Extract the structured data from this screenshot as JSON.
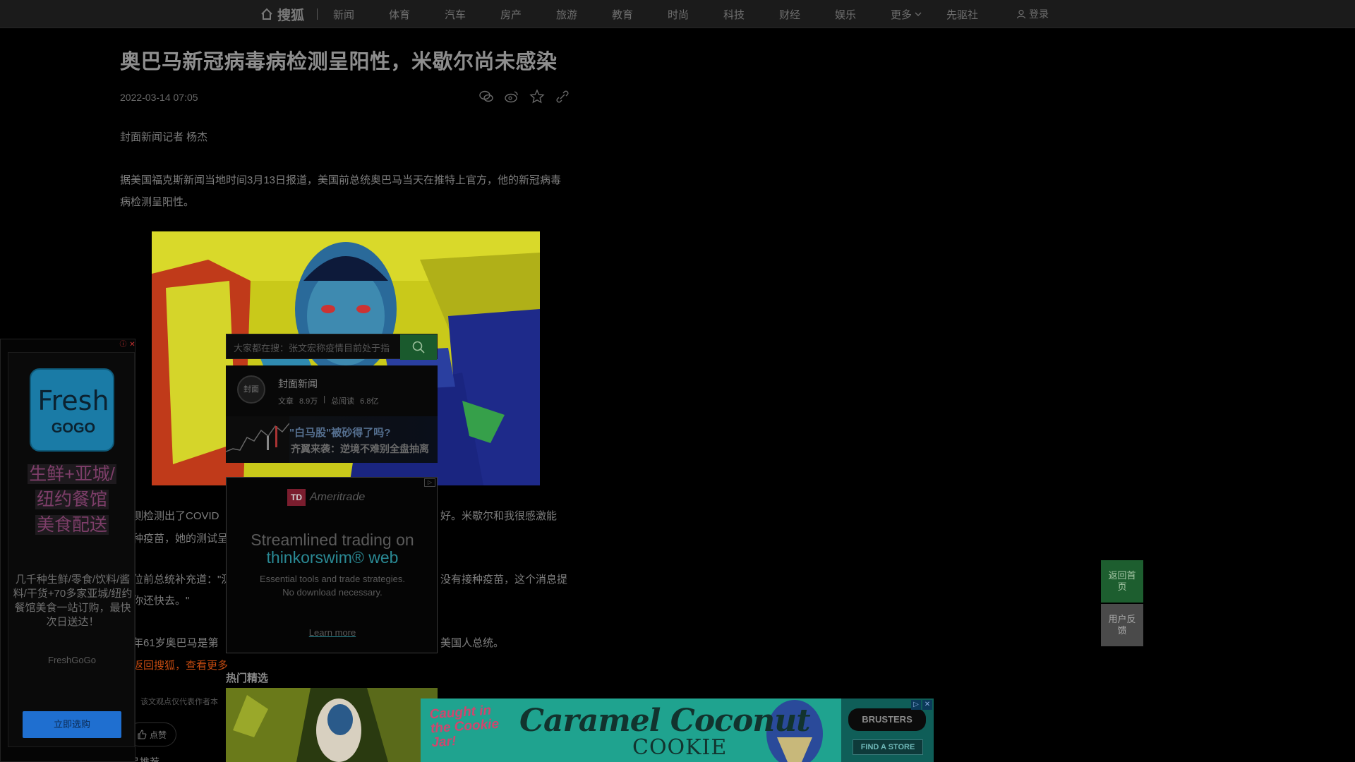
{
  "nav": {
    "home_label": "搜狐",
    "items": [
      "新闻",
      "体育",
      "汽车",
      "房产",
      "旅游",
      "教育",
      "时尚",
      "科技",
      "财经",
      "娱乐"
    ],
    "more_label": "更多",
    "extra_label": "先驱社",
    "login_label": "登录"
  },
  "article": {
    "title": "奥巴马新冠病毒病检测呈阳性，米歇尔尚未感染",
    "date": "2022-03-14 07:05",
    "byline": "封面新闻记者 杨杰",
    "para1": "据美国福克斯新闻当地时间3月13日报道，美国前总统奥巴马当天在推特上官方，他的新冠病毒病检测呈阳性。",
    "para2_left": "测检测出了COVID",
    "para2_right": "好。米歇尔和我很感激能",
    "para3_left": "种疫苗，她的测试呈",
    "para4_left": "位前总统补充道：\"测",
    "para4_right": "没有接种疫苗，这个消息提",
    "para5_left": "你还快去。\"",
    "para6_left": "年61岁奥巴马是第",
    "para6_right": "美国人总统。",
    "back_link": "返回搜狐，查看更多",
    "disclaimer": "：该文观点仅代表作者本",
    "like_label": "点赞",
    "next_label": "作品推荐"
  },
  "search_popup": {
    "placeholder": "大家都在搜：张文宏称疫情目前处于指",
    "author_name": "封面新闻",
    "author_avatar_text": "封面",
    "articles_label": "文章",
    "articles_count": "8.9万",
    "reads_label": "总阅读",
    "reads_count": "6.8亿",
    "promo_line1": "\"白马股\"被砂得了吗?",
    "promo_line2": "齐翼来袭：逆境不难别全盘抽离"
  },
  "td_ad": {
    "logo_box": "TD",
    "logo_name": "Ameritrade",
    "headline1": "Streamlined trading on",
    "headline2": "thinkorswim® web",
    "sub1": "Essential tools and trade strategies.",
    "sub2": "No download necessary.",
    "cta": "Learn more"
  },
  "left_ad": {
    "logo_word": "Fresh",
    "logo_gogo": "GOGO",
    "headline": [
      "生鲜+亚城/",
      "纽约餐馆",
      "美食配送"
    ],
    "body": "几千种生鲜/零食/饮料/酱料/干货+70多家亚城/纽约餐馆美食一站订购，最快次日送达！",
    "brand": "FreshGoGo",
    "cta": "立即选购"
  },
  "hot": {
    "title": "热门精选"
  },
  "banner": {
    "caught": "Caught in the Cookie Jar!",
    "main": "Caramel Coconut",
    "cookie": "COOKIE",
    "brand": "BRUSTERS",
    "find": "FIND A STORE"
  },
  "float": {
    "home": "返回首页",
    "feedback": "用户反馈"
  }
}
